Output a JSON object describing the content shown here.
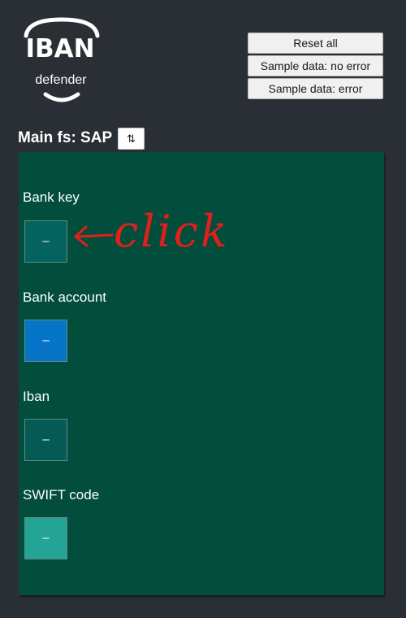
{
  "logo": {
    "title": "IBAN",
    "subtitle": "defender"
  },
  "actions": {
    "reset_label": "Reset all",
    "sample_no_error_label": "Sample data: no error",
    "sample_error_label": "Sample data: error"
  },
  "section": {
    "title": "Main fs: SAP",
    "swap_label": "⇅"
  },
  "fields": [
    {
      "label": "Bank key",
      "value": "–",
      "color": "#04625f"
    },
    {
      "label": "Bank account",
      "value": "–",
      "color": "#0675c8"
    },
    {
      "label": "Iban",
      "value": "–",
      "color": "#045a55"
    },
    {
      "label": "SWIFT code",
      "value": "–",
      "color": "#23a494"
    }
  ],
  "annotation": {
    "text": "click",
    "color": "#e0201a"
  },
  "colors": {
    "background": "#2a2f35",
    "panel": "#034d3c"
  }
}
